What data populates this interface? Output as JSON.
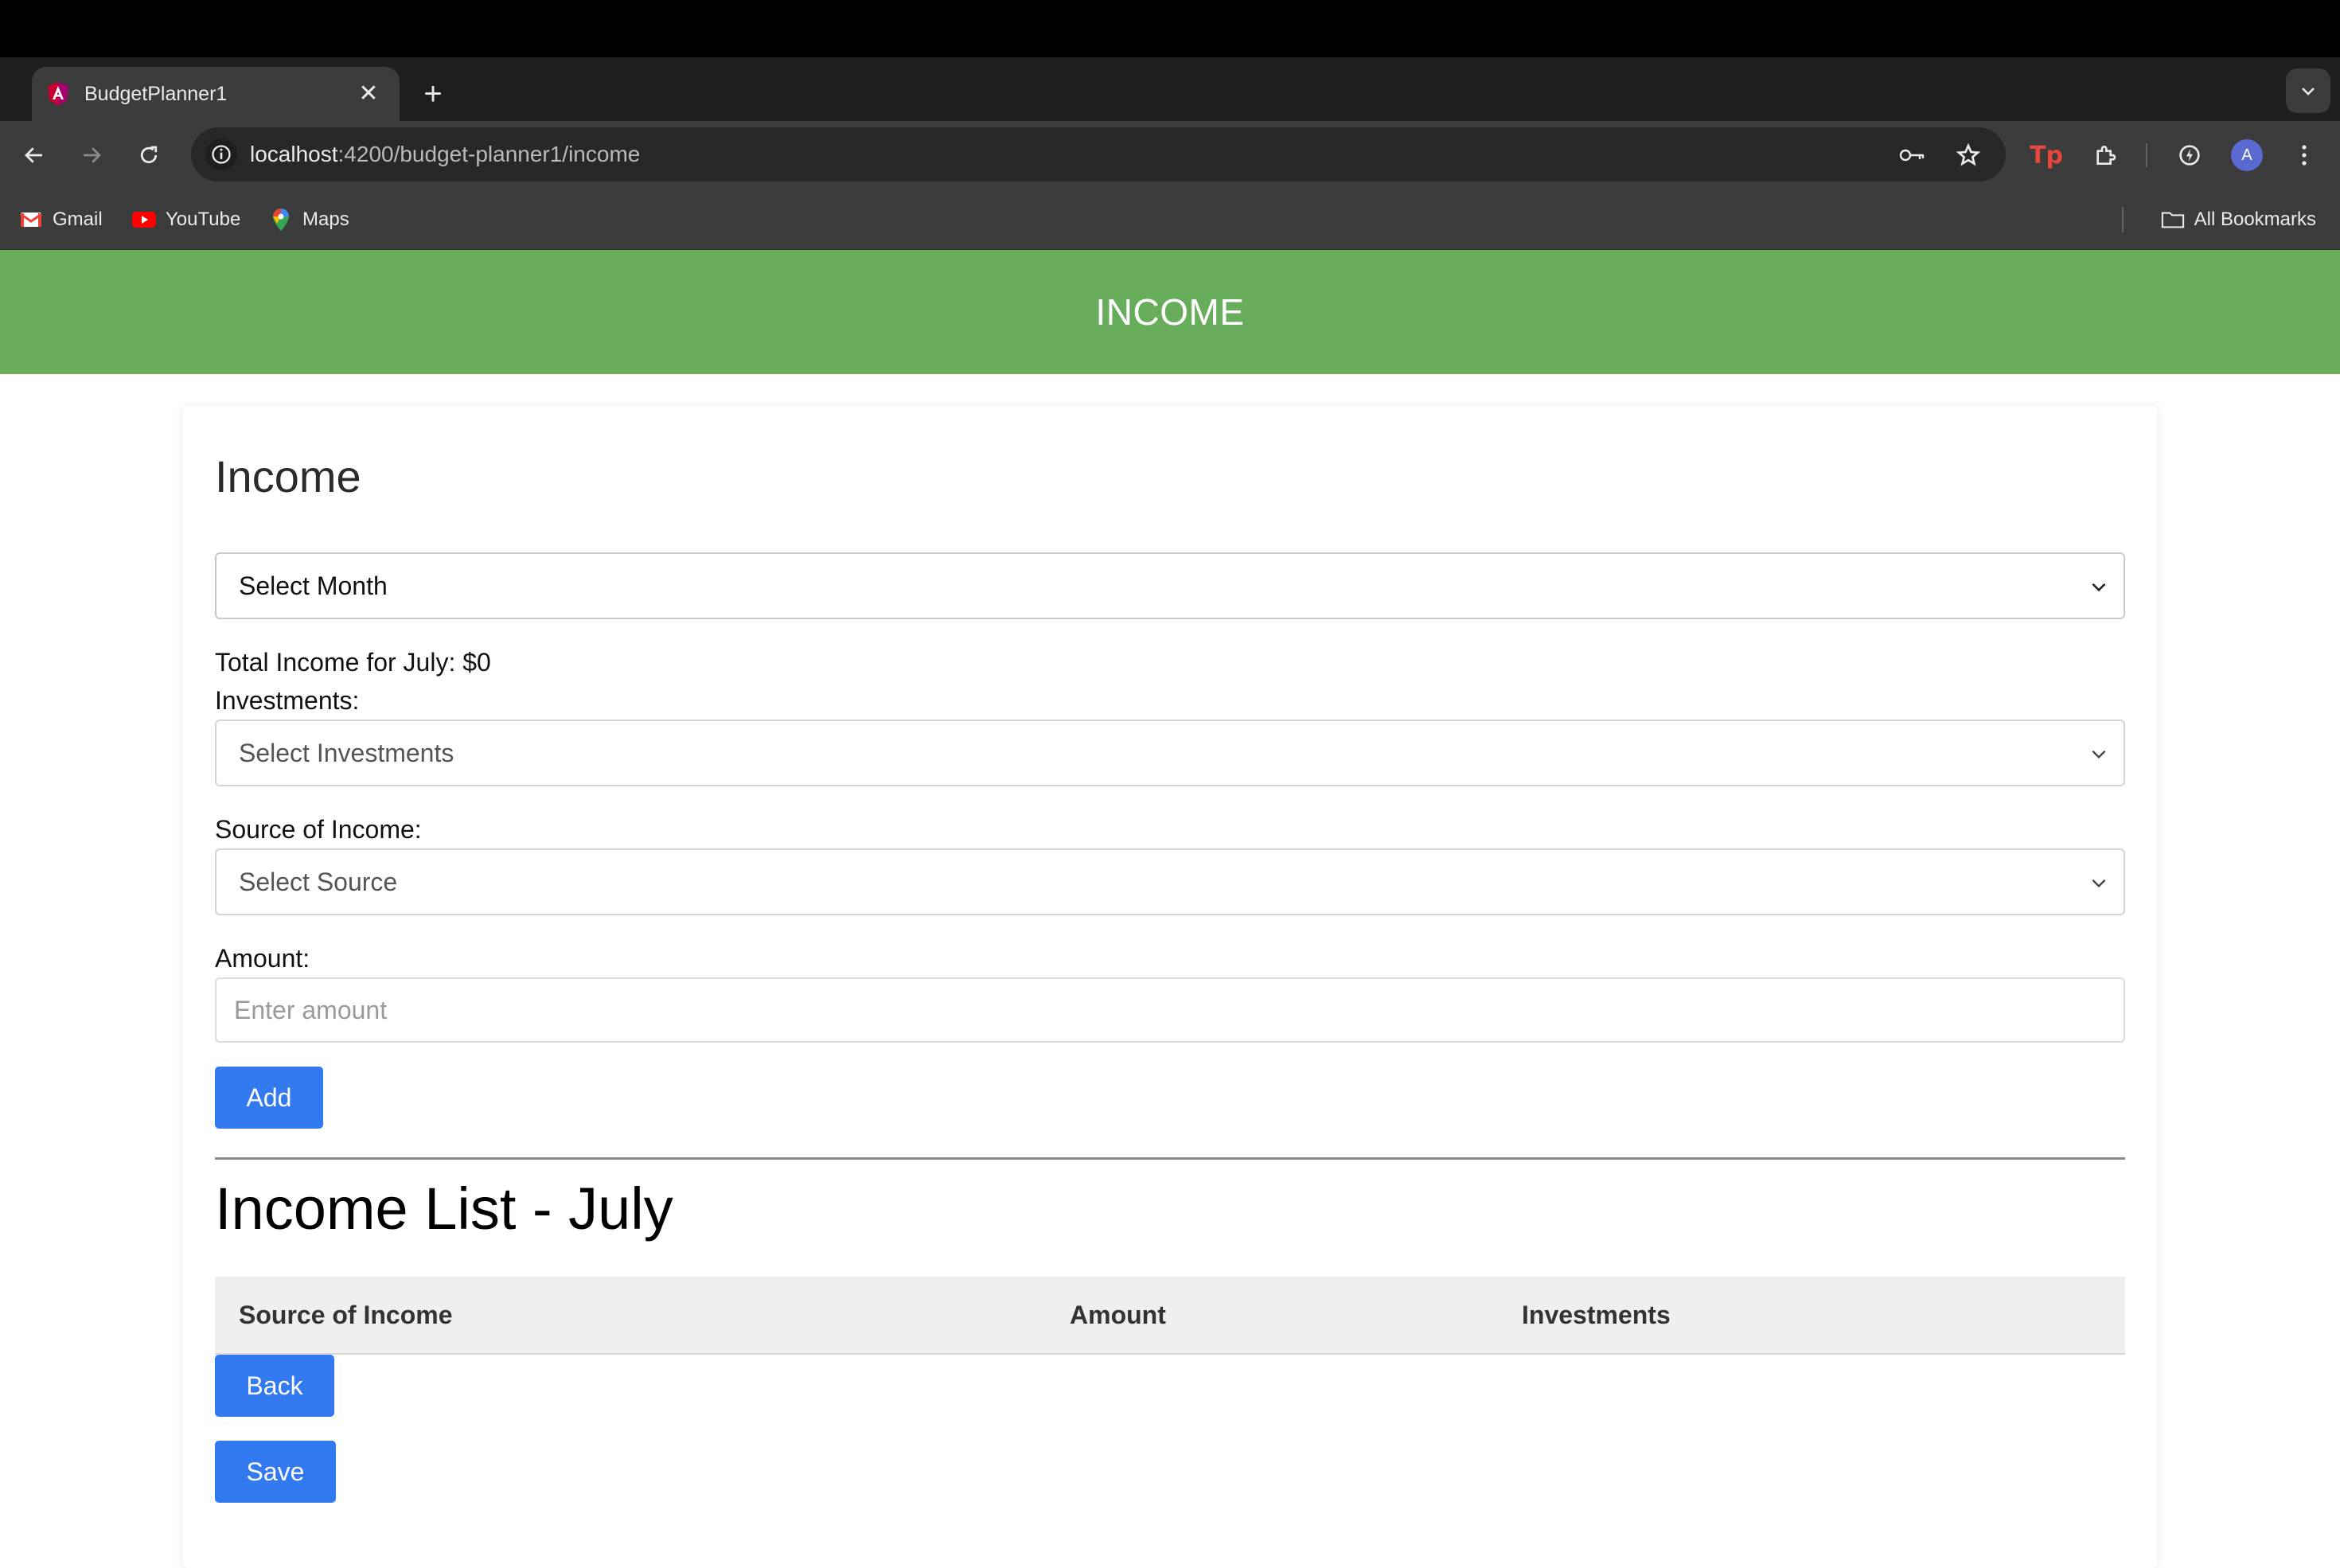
{
  "browser": {
    "tab_title": "BudgetPlanner1",
    "url_host": "localhost",
    "url_path": ":4200/budget-planner1/income",
    "avatar_letter": "A",
    "bookmarks": [
      {
        "label": "Gmail",
        "icon": "gmail-icon"
      },
      {
        "label": "YouTube",
        "icon": "youtube-icon"
      },
      {
        "label": "Maps",
        "icon": "maps-icon"
      }
    ],
    "all_bookmarks_label": "All Bookmarks"
  },
  "header": {
    "title": "INCOME",
    "color": "#68ad5b"
  },
  "form": {
    "heading": "Income",
    "month_select": "Select Month",
    "total_income_text": "Total Income for July: $0",
    "investments_label": "Investments:",
    "investments_select": "Select Investments",
    "source_label": "Source of Income:",
    "source_select": "Select Source",
    "amount_label": "Amount:",
    "amount_placeholder": "Enter amount",
    "amount_value": "",
    "add_button": "Add"
  },
  "income_list": {
    "heading": "Income List - July",
    "columns": [
      "Source of Income",
      "Amount",
      "Investments"
    ],
    "rows": []
  },
  "actions": {
    "back_button": "Back",
    "save_button": "Save",
    "accent": "#3379f0"
  }
}
